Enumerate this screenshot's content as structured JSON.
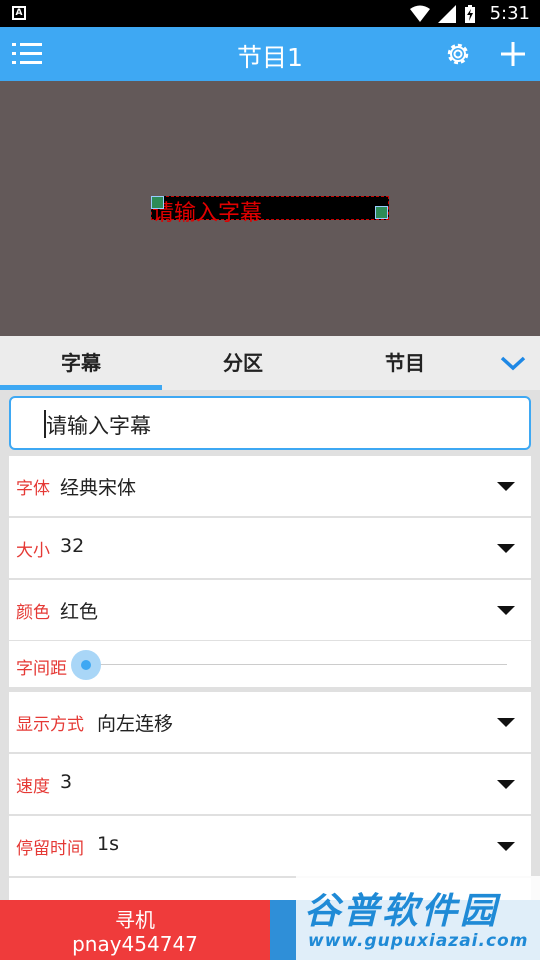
{
  "statusbar": {
    "time": "5:31"
  },
  "appbar": {
    "title": "节目1"
  },
  "preview": {
    "text": "请输入字幕"
  },
  "tabs": [
    {
      "label": "字幕",
      "active": true
    },
    {
      "label": "分区",
      "active": false
    },
    {
      "label": "节目",
      "active": false
    }
  ],
  "subtitle_input": {
    "value": "请输入字幕"
  },
  "settings": {
    "font": {
      "label": "字体",
      "value": "经典宋体"
    },
    "size": {
      "label": "大小",
      "value": "32"
    },
    "color": {
      "label": "颜色",
      "value": "红色"
    },
    "spacing": {
      "label": "字间距",
      "level": 0
    },
    "display_mode": {
      "label": "显示方式",
      "value": "向左连移"
    },
    "speed": {
      "label": "速度",
      "value": "3"
    },
    "dwell_time": {
      "label": "停留时间",
      "value": "1s"
    }
  },
  "bottom_bar": {
    "search_label": "寻机",
    "device_id": "pnay454747"
  },
  "watermark": {
    "title": "谷普软件园",
    "url": "www.gupuxiazai.com"
  },
  "colors": {
    "accent": "#3ea8f3",
    "label_red": "#e53935",
    "preview_bg": "#635959",
    "search_button": "#ef3b3b"
  }
}
